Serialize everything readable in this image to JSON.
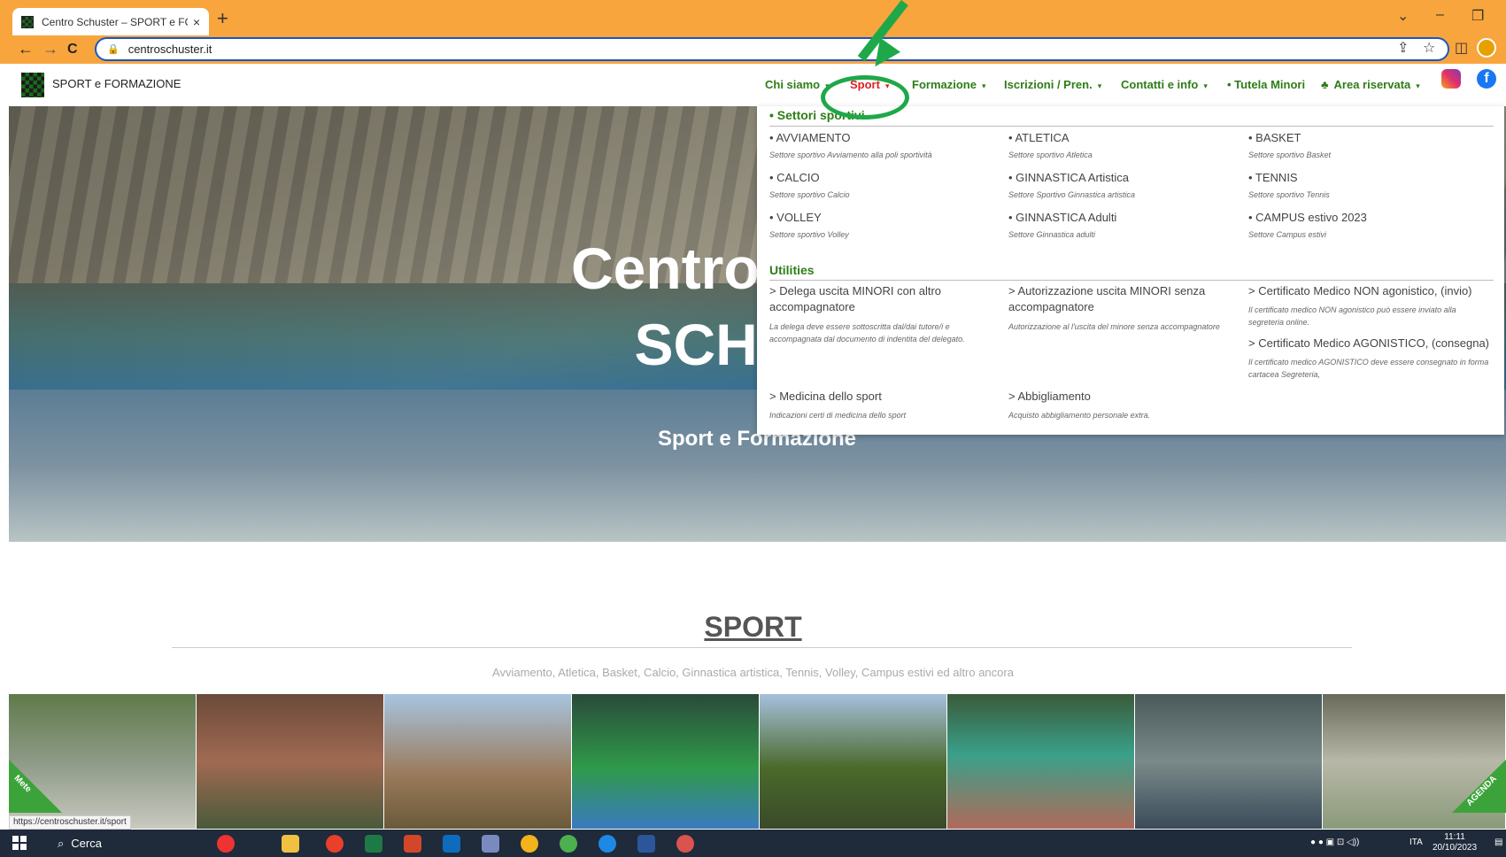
{
  "browser": {
    "tab_title": "Centro Schuster – SPORT e FORI",
    "tab_close": "×",
    "new_tab": "+",
    "url": "centroschuster.it",
    "status_url": "https://centroschuster.it/sport",
    "nav_back": "←",
    "nav_forward": "→",
    "nav_reload": "C"
  },
  "header": {
    "site_title": "SPORT e FORMAZIONE",
    "menu": [
      {
        "label": "Chi siamo"
      },
      {
        "label": "Sport"
      },
      {
        "label": "Formazione"
      },
      {
        "label": "Iscrizioni / Pren."
      },
      {
        "label": "Contatti e info"
      },
      {
        "label": "• Tutela Minori"
      },
      {
        "label": "Area riservata"
      }
    ]
  },
  "hero": {
    "title_line1": "Centro gio",
    "title_line2": "SCHU",
    "subtitle": "Sport e Formazione"
  },
  "dropdown": {
    "section1_title": "• Settori sportivi",
    "sports": [
      {
        "label": "• AVVIAMENTO",
        "desc": "Settore sportivo Avviamento alla poli sportività"
      },
      {
        "label": "• ATLETICA",
        "desc": "Settore sportivo Atletica"
      },
      {
        "label": "• BASKET",
        "desc": "Settore sportivo Basket"
      },
      {
        "label": "• CALCIO",
        "desc": "Settore sportivo Calcio"
      },
      {
        "label": "• GINNASTICA Artistica",
        "desc": "Settore Sportivo Ginnastica artistica"
      },
      {
        "label": "• TENNIS",
        "desc": "Settore sportivo Tennis"
      },
      {
        "label": "• VOLLEY",
        "desc": "Settore sportivo Volley"
      },
      {
        "label": "• GINNASTICA Adulti",
        "desc": "Settore Ginnastica adulti"
      },
      {
        "label": "• CAMPUS estivo 2023",
        "desc": "Settore Campus estivi"
      }
    ],
    "section2_title": "Utilities",
    "utilities": [
      {
        "label": "> Delega uscita MINORI con altro accompagnatore",
        "desc": "La delega deve essere sottoscritta dal/dai tutore/i e accompagnata dal documento di indentita del delegato."
      },
      {
        "label": "> Autorizzazione uscita MINORI senza accompagnatore",
        "desc": "Autorizzazione al l'uscita del minore senza accompagnatore"
      },
      {
        "label": "> Certificato Medico NON agonistico, (invio)",
        "desc": "Il certificato medico NON agonistico può essere inviato alla segreteria online."
      },
      {
        "label": "> Certificato Medico AGONISTICO, (consegna)",
        "desc": "Il certificato medico AGONISTICO deve essere consegnato in forma cartacea Segreteria,"
      },
      {
        "label": "> Medicina dello sport",
        "desc": "Indicazioni certi di medicina dello sport"
      },
      {
        "label": "> Abbigliamento",
        "desc": "Acquisto abbigliamento personale extra."
      }
    ]
  },
  "sport_section": {
    "title": "SPORT",
    "subtitle": "Avviamento, Atletica, Basket, Calcio, Ginnastica artistica, Tennis, Volley, Campus estivi ed altro ancora",
    "badge_left": "Mete",
    "badge_right": "AGENDA"
  },
  "taskbar": {
    "search": "Cerca",
    "lang": "ITA",
    "time": "11:11",
    "date": "20/10/2023"
  },
  "colors": {
    "chrome_orange": "#f8a53d",
    "menu_green": "#2e7d17",
    "menu_active": "#dd2222",
    "annotation_green": "#1fa84a"
  }
}
